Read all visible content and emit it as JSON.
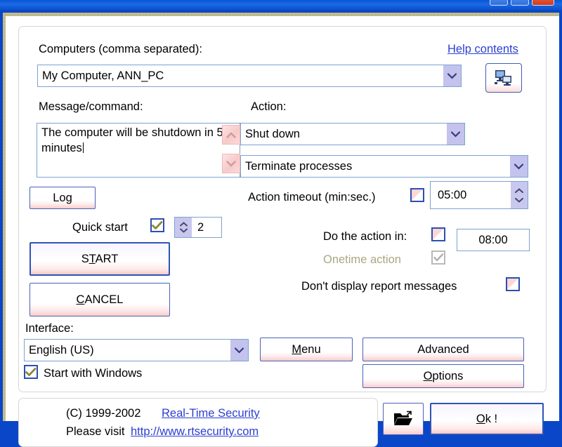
{
  "window": {
    "titlebar_buttons": [
      "minimize",
      "maximize",
      "close"
    ]
  },
  "main": {
    "computers_label": "Computers (comma separated):",
    "computers_value": "My Computer, ANN_PC",
    "help_link": "Help contents",
    "browse_computers_tooltip": "Browse computers",
    "message_label": "Message/command:",
    "message_value": "The computer will be shutdown in 5 minutes",
    "action_label": "Action:",
    "action_value": "Shut down",
    "action_mode_value": "Terminate processes",
    "log_button": "Log",
    "quick_start_label": "Quick start",
    "quick_start_checked": true,
    "quick_start_value": "2",
    "start_button": "START",
    "start_button_accel": "T",
    "cancel_button": "CANCEL",
    "cancel_button_accel": "C",
    "action_timeout_label": "Action timeout (min:sec.)",
    "action_timeout_checked": false,
    "action_timeout_value": "05:00",
    "do_action_in_label": "Do the action in:",
    "do_action_in_checked": false,
    "do_action_in_value": "08:00",
    "onetime_action_label": "Onetime action",
    "onetime_action_checked": true,
    "onetime_action_disabled": true,
    "no_report_label": "Don't display report messages",
    "no_report_checked": false,
    "interface_label": "Interface:",
    "interface_value": "English (US)",
    "start_with_windows_label": "Start with Windows",
    "start_with_windows_checked": true,
    "menu_button": "Menu",
    "menu_button_accel": "M",
    "advanced_button": "Advanced",
    "options_button": "Options",
    "options_button_accel": "O"
  },
  "footer": {
    "copyright": "(C) 1999-2002",
    "company_link": "Real-Time Security",
    "visit_text": "Please visit",
    "visit_url": "http://www.rtsecurity.com",
    "open_button_icon": "folder-open-icon",
    "ok_button": "Ok !",
    "ok_button_accel": "O"
  },
  "colors": {
    "accent_blue": "#0a46c8",
    "link_blue": "#2b3fd0",
    "button_border": "#4a62b8",
    "input_border": "#7da2cf",
    "checkbox_unchecked_fill": "#fdd6d6",
    "check_mark": "#8a8a3d",
    "combo_arrow_bg": "#c3c3ee"
  }
}
